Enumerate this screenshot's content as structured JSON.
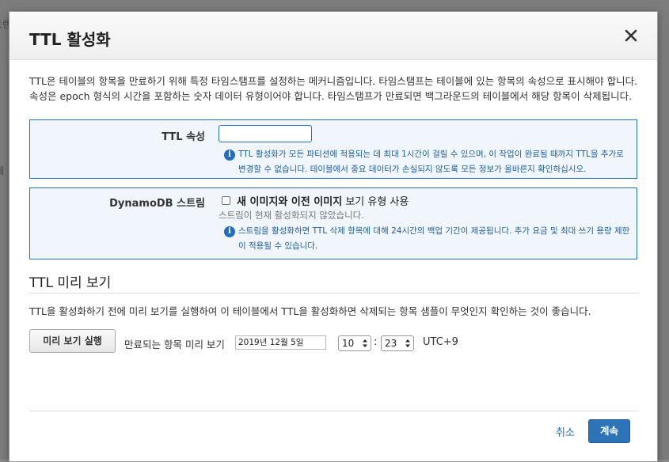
{
  "background": {
    "fragments": [
      "트랜",
      "테"
    ]
  },
  "modal": {
    "title": "TTL 활성화",
    "description": "TTL은 테이블의 항목을 만료하기 위해 특정 타임스탬프를 설정하는 메커니즘입니다. 타임스탬프는 테이블에 있는 항목의 속성으로 표시해야 합니다. 속성은 epoch 형식의 시간을 포함하는 숫자 데이터 유형이어야 합니다. 타임스탬프가 만료되면 백그라운드의 테이블에서 해당 항목이 삭제됩니다.",
    "ttl_attribute": {
      "label": "TTL 속성",
      "value": "",
      "info": "TTL 활성화가 모든 파티션에 적용되는 데 최대 1시간이 걸릴 수 있으며, 이 작업이 완료될 때까지 TTL을 추가로 변경할 수 없습니다. 테이블에서 중요 데이터가 손실되지 않도록 모든 정보가 올바른지 확인하십시오."
    },
    "stream": {
      "label": "DynamoDB 스트림",
      "checkbox_bold": "새 이미지와 이전 이미지",
      "checkbox_rest": " 보기 유형 사용",
      "checked": false,
      "status": "스트림이 현재 활성화되지 않았습니다.",
      "info": "스트림을 활성화하면 TTL 삭제 항목에 대해 24시간의 백업 기간이 제공됩니다. 추가 요금 및 최대 쓰기 용량 제한이 적용될 수 있습니다."
    },
    "preview": {
      "title": "TTL 미리 보기",
      "description": "TTL을 활성화하기 전에 미리 보기를 실행하여 이 테이블에서 TTL을 활성화하면 삭제되는 항목 샘플이 무엇인지 확인하는 것이 좋습니다.",
      "run_button": "미리 보기 실행",
      "expire_label": "만료되는 항목 미리 보기",
      "date": "2019년 12월 5일",
      "hour": "10",
      "minute": "23",
      "timezone": "UTC+9"
    },
    "footer": {
      "cancel": "취소",
      "continue": "계속"
    }
  },
  "colors": {
    "accent": "#1f6ebf",
    "primary_button": "#2e73b8",
    "panel_bg": "#f0f6fc"
  },
  "icons": [
    "close-icon",
    "info-icon",
    "updown-arrow-icon"
  ]
}
